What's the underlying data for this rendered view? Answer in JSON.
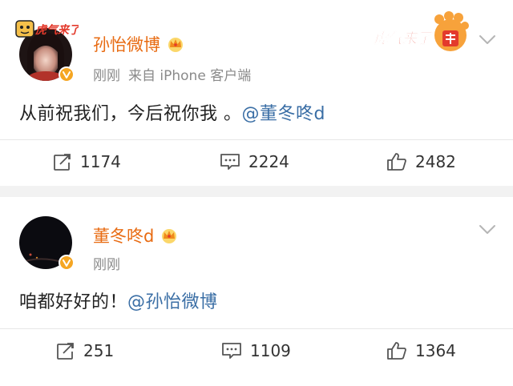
{
  "posts": [
    {
      "username": "孙怡微博",
      "time": "刚刚",
      "source": "来自 iPhone 客户端",
      "text": "从前祝我们，今后祝你我 。",
      "mention": "@董冬咚d",
      "avatar_badge": "虎气来了",
      "header_sticker": "虎气来了",
      "repost_count": "1174",
      "comment_count": "2224",
      "like_count": "2482"
    },
    {
      "username": "董冬咚d",
      "time": "刚刚",
      "text": "咱都好好的！",
      "mention": "@孙怡微博",
      "repost_count": "251",
      "comment_count": "1109",
      "like_count": "1364"
    }
  ],
  "colors": {
    "username": "#e86b12",
    "mention": "#3a6ea5",
    "meta": "#8a8a8a",
    "verified": "#f5a623",
    "page_bg": "#f2f2f2"
  },
  "icons": [
    "repost-icon",
    "comment-icon",
    "like-icon",
    "chevron-down-icon",
    "crown-icon",
    "verified-badge-icon"
  ]
}
